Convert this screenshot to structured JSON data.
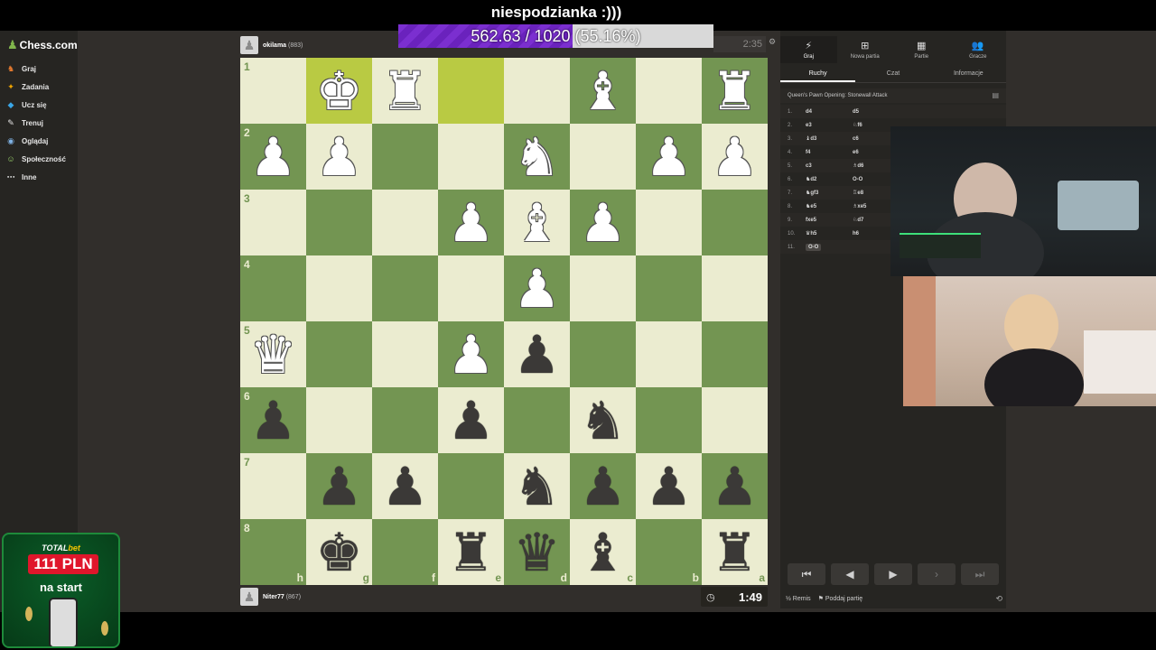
{
  "stream": {
    "goal_title": "niespodzianka :)))",
    "goal_text": "562.63 / 1020 (55.16%)",
    "goal_progress": 0.5516
  },
  "sidebar": {
    "logo": "Chess.com",
    "items": [
      {
        "label": "Graj",
        "icon": "play-icon"
      },
      {
        "label": "Zadania",
        "icon": "puzzle-icon"
      },
      {
        "label": "Ucz się",
        "icon": "learn-icon"
      },
      {
        "label": "Trenuj",
        "icon": "train-icon"
      },
      {
        "label": "Oglądaj",
        "icon": "watch-icon"
      },
      {
        "label": "Społeczność",
        "icon": "community-icon"
      },
      {
        "label": "Inne",
        "icon": "more-icon"
      }
    ]
  },
  "promo": {
    "brand_prefix": "TOTAL",
    "brand_suffix": "bet",
    "amount": "111 PLN",
    "subtitle": "na start"
  },
  "top_player": {
    "name": "okilama",
    "rating": "(883)",
    "clock": "2:35"
  },
  "bottom_player": {
    "name": "Niter77",
    "rating": "(867)",
    "clock": "1:49"
  },
  "board": {
    "ranks": [
      "1",
      "2",
      "3",
      "4",
      "5",
      "6",
      "7",
      "8"
    ],
    "files": [
      "h",
      "g",
      "f",
      "e",
      "d",
      "c",
      "b",
      "a"
    ],
    "highlight": [
      "1-1",
      "1-3"
    ],
    "pieces": {
      "1-1": "wK",
      "1-2": "wR",
      "1-5": "wB",
      "1-7": "wR",
      "2-0": "wP",
      "2-1": "wP",
      "2-4": "wN",
      "2-6": "wP",
      "2-7": "wP",
      "3-3": "wP",
      "3-4": "wB",
      "3-5": "wP",
      "4-4": "wP",
      "5-0": "wQ",
      "5-3": "wP",
      "5-4": "bP",
      "6-0": "bP",
      "6-3": "bP",
      "6-5": "bN",
      "7-1": "bP",
      "7-2": "bP",
      "7-4": "bN",
      "7-5": "bP",
      "7-6": "bP",
      "7-7": "bP",
      "8-1": "bK",
      "8-3": "bR",
      "8-4": "bQ",
      "8-5": "bB",
      "8-7": "bR"
    }
  },
  "panel": {
    "tabs": [
      {
        "label": "Graj",
        "icon": "bolt-icon"
      },
      {
        "label": "Nowa partia",
        "icon": "plus-icon"
      },
      {
        "label": "Partie",
        "icon": "games-icon"
      },
      {
        "label": "Gracze",
        "icon": "players-icon"
      }
    ],
    "subtabs": [
      "Ruchy",
      "Czat",
      "Informacje"
    ],
    "opening": "Queen's Pawn Opening: Stonewall Attack",
    "moves": [
      {
        "n": "1.",
        "w": "d4",
        "b": "d5"
      },
      {
        "n": "2.",
        "w": "e3",
        "b": "♘f6"
      },
      {
        "n": "3.",
        "w": "♝d3",
        "b": "c6"
      },
      {
        "n": "4.",
        "w": "f4",
        "b": "e6"
      },
      {
        "n": "5.",
        "w": "c3",
        "b": "♗d6"
      },
      {
        "n": "6.",
        "w": "♞d2",
        "b": "O-O"
      },
      {
        "n": "7.",
        "w": "♞gf3",
        "b": "♖e8"
      },
      {
        "n": "8.",
        "w": "♞e5",
        "b": "♗xe5"
      },
      {
        "n": "9.",
        "w": "fxe5",
        "b": "♘d7"
      },
      {
        "n": "10.",
        "w": "♛h5",
        "b": "h6"
      },
      {
        "n": "11.",
        "w": "O-O",
        "b": ""
      }
    ],
    "draw_label": "Remis",
    "resign_label": "Poddaj partię"
  },
  "colors": {
    "light_square": "#ebecd0",
    "dark_square": "#739552",
    "highlight": "#b9ca43",
    "goal_purple": "#7b2fd0"
  }
}
